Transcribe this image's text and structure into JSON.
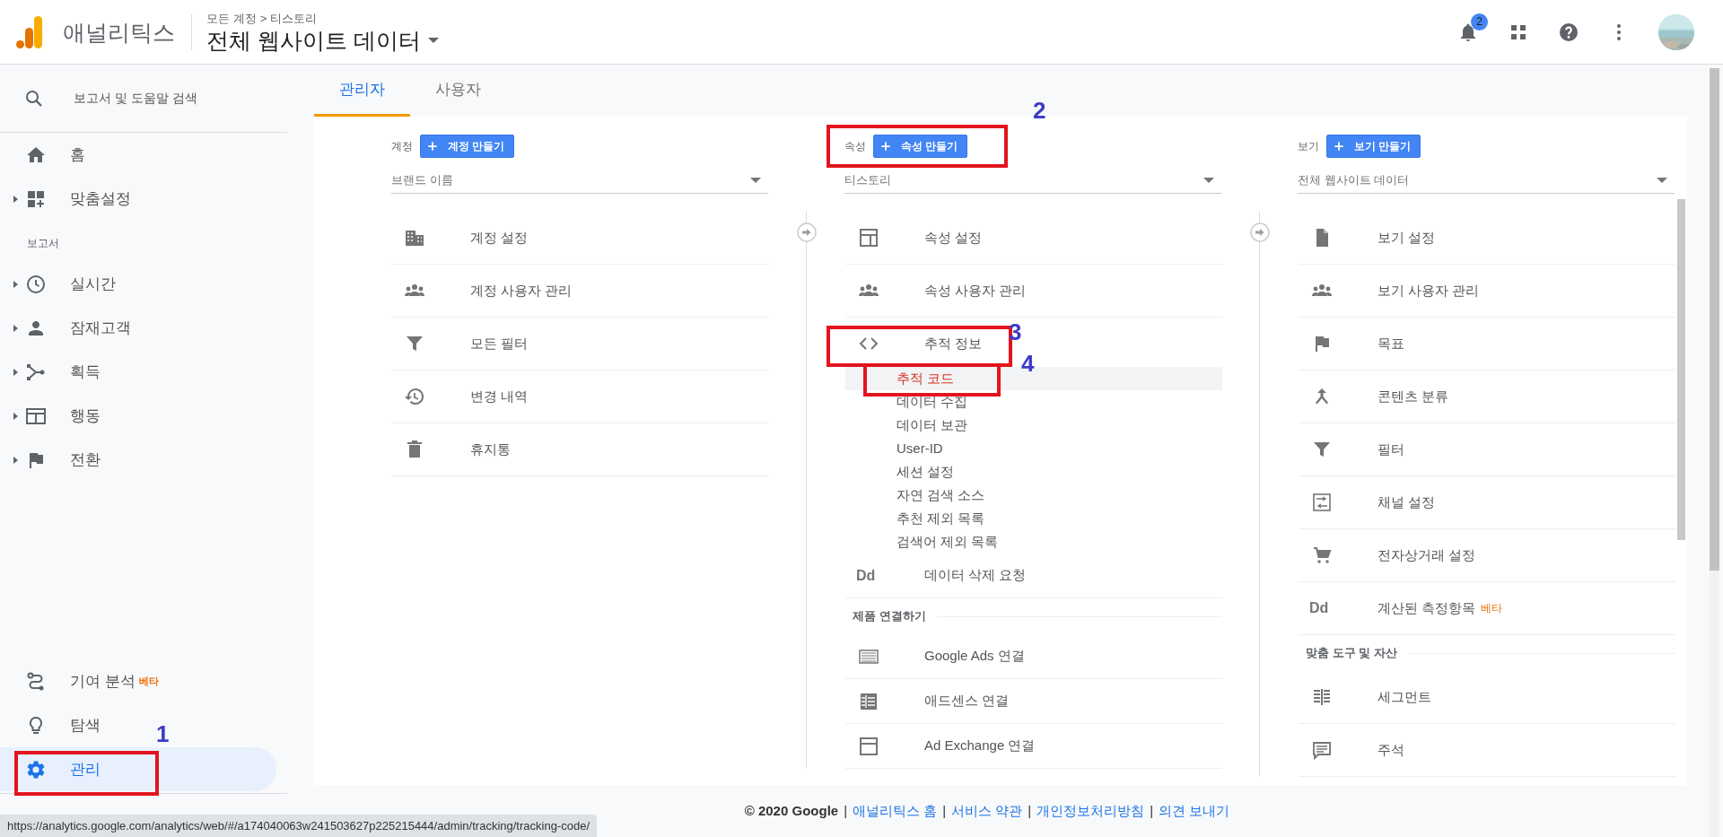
{
  "header": {
    "app_name": "애널리틱스",
    "breadcrumb": [
      "모든 계정",
      "티스토리"
    ],
    "breadcrumb_separator": ">",
    "title": "전체 웹사이트 데이터",
    "notification_count": "2"
  },
  "sidebar": {
    "search": {
      "placeholder": "보고서 및 도움말 검색"
    },
    "top_items": [
      {
        "label": "홈",
        "expandable": false,
        "selected": false
      },
      {
        "label": "맞춤설정",
        "expandable": true,
        "selected": false
      }
    ],
    "section": "보고서",
    "report_items": [
      {
        "label": "실시간",
        "expandable": true,
        "selected": false
      },
      {
        "label": "잠재고객",
        "expandable": true,
        "selected": false
      },
      {
        "label": "획득",
        "expandable": true,
        "selected": false
      },
      {
        "label": "행동",
        "expandable": true,
        "selected": false
      },
      {
        "label": "전환",
        "expandable": true,
        "selected": false
      }
    ],
    "bottom_items": [
      {
        "label": "기여 분석",
        "badge": "베타",
        "selected": false
      },
      {
        "label": "탐색",
        "selected": false
      },
      {
        "label": "관리",
        "selected": true,
        "annotation": "1"
      }
    ]
  },
  "tabs": [
    {
      "label": "관리자",
      "selected": true
    },
    {
      "label": "사용자",
      "selected": false
    }
  ],
  "columns": [
    {
      "label": "계정",
      "create_button": "계정 만들기",
      "dropdown": "브랜드 이름",
      "items": [
        {
          "kind": "link",
          "label": "계정 설정"
        },
        {
          "kind": "link",
          "label": "계정 사용자 관리"
        },
        {
          "kind": "link",
          "label": "모든 필터"
        },
        {
          "kind": "link",
          "label": "변경 내역"
        },
        {
          "kind": "link",
          "label": "휴지통"
        }
      ]
    },
    {
      "label": "속성",
      "create_button": "속성 만들기",
      "dropdown": "티스토리",
      "annotation": "2",
      "items": [
        {
          "kind": "link",
          "label": "속성 설정"
        },
        {
          "kind": "link",
          "label": "속성 사용자 관리"
        },
        {
          "kind": "link",
          "label": "추적 정보",
          "annotation": "3",
          "children": [
            {
              "label": "추적 코드",
              "selected": true,
              "annotation": "4"
            },
            {
              "label": "데이터 수집",
              "selected": false
            },
            {
              "label": "데이터 보관",
              "selected": false
            },
            {
              "label": "User-ID",
              "selected": false
            },
            {
              "label": "세션 설정",
              "selected": false
            },
            {
              "label": "자연 검색 소스",
              "selected": false
            },
            {
              "label": "추천 제외 목록",
              "selected": false
            },
            {
              "label": "검색어 제외 목록",
              "selected": false
            }
          ]
        },
        {
          "kind": "link",
          "label": "데이터 삭제 요청",
          "icon_text": "Dd"
        },
        {
          "kind": "section",
          "label": "제품 연결하기"
        },
        {
          "kind": "link",
          "label": "Google Ads 연결"
        },
        {
          "kind": "link",
          "label": "애드센스 연결"
        },
        {
          "kind": "link",
          "label": "Ad Exchange 연결"
        }
      ]
    },
    {
      "label": "보기",
      "create_button": "보기 만들기",
      "dropdown": "전체 웹사이트 데이터",
      "items": [
        {
          "kind": "link",
          "label": "보기 설정"
        },
        {
          "kind": "link",
          "label": "보기 사용자 관리"
        },
        {
          "kind": "link",
          "label": "목표"
        },
        {
          "kind": "link",
          "label": "콘텐츠 분류"
        },
        {
          "kind": "link",
          "label": "필터"
        },
        {
          "kind": "link",
          "label": "채널 설정"
        },
        {
          "kind": "link",
          "label": "전자상거래 설정"
        },
        {
          "kind": "link",
          "label": "계산된 측정항목",
          "icon_text": "Dd",
          "badge": "베타"
        },
        {
          "kind": "section",
          "label": "맞춤 도구 및 자산"
        },
        {
          "kind": "link",
          "label": "세그먼트"
        },
        {
          "kind": "link",
          "label": "주석"
        }
      ]
    }
  ],
  "footer": {
    "copyright": "© 2020 Google",
    "separator": "|",
    "links": [
      "애널리틱스 홈",
      "서비스 약관",
      "개인정보처리방침",
      "의견 보내기"
    ]
  },
  "status_bar": {
    "url": "https://analytics.google.com/analytics/web/#/a174040063w241503627p225215444/admin/tracking/tracking-code/"
  }
}
